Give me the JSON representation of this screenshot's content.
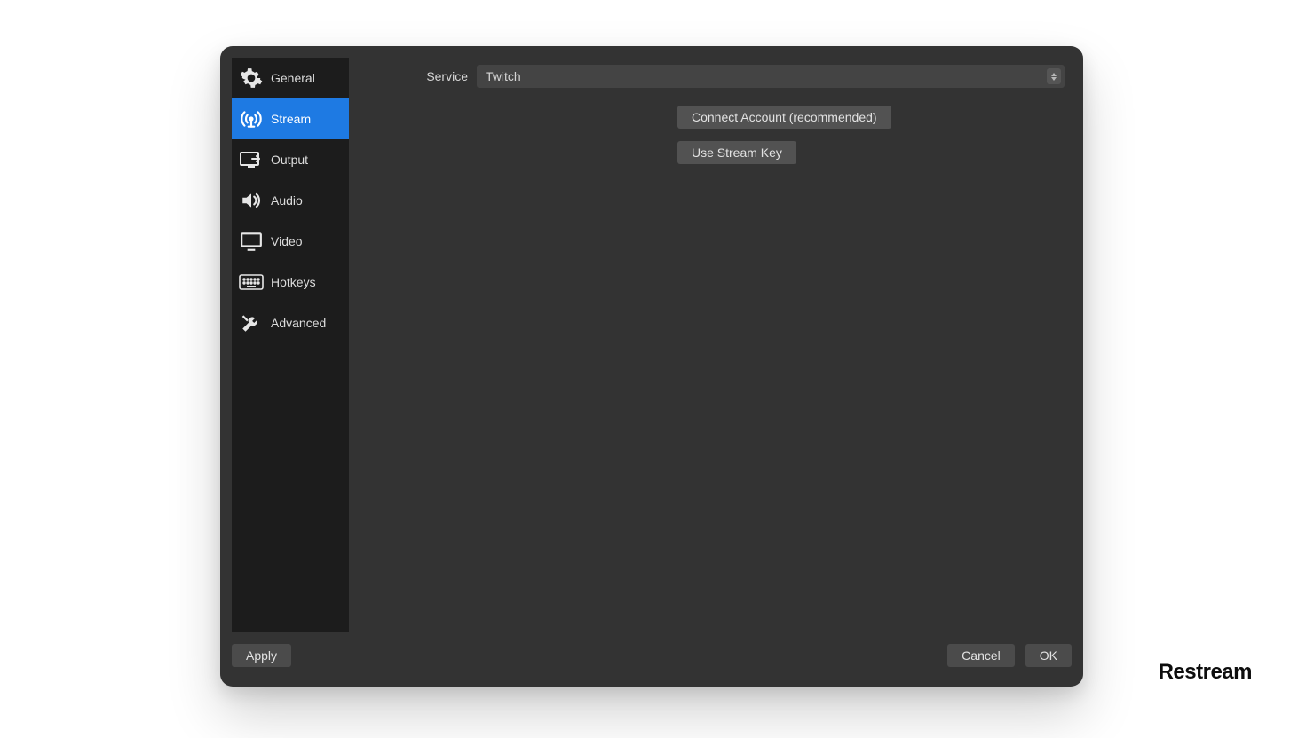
{
  "sidebar": {
    "items": [
      {
        "label": "General",
        "icon": "gear"
      },
      {
        "label": "Stream",
        "icon": "antenna"
      },
      {
        "label": "Output",
        "icon": "output"
      },
      {
        "label": "Audio",
        "icon": "speaker"
      },
      {
        "label": "Video",
        "icon": "monitor"
      },
      {
        "label": "Hotkeys",
        "icon": "keyboard"
      },
      {
        "label": "Advanced",
        "icon": "tools"
      }
    ],
    "active_index": 1
  },
  "main": {
    "service_label": "Service",
    "service_value": "Twitch",
    "buttons": {
      "connect": "Connect Account (recommended)",
      "streamkey": "Use Stream Key"
    }
  },
  "footer": {
    "apply": "Apply",
    "cancel": "Cancel",
    "ok": "OK"
  },
  "brand": "Restream"
}
